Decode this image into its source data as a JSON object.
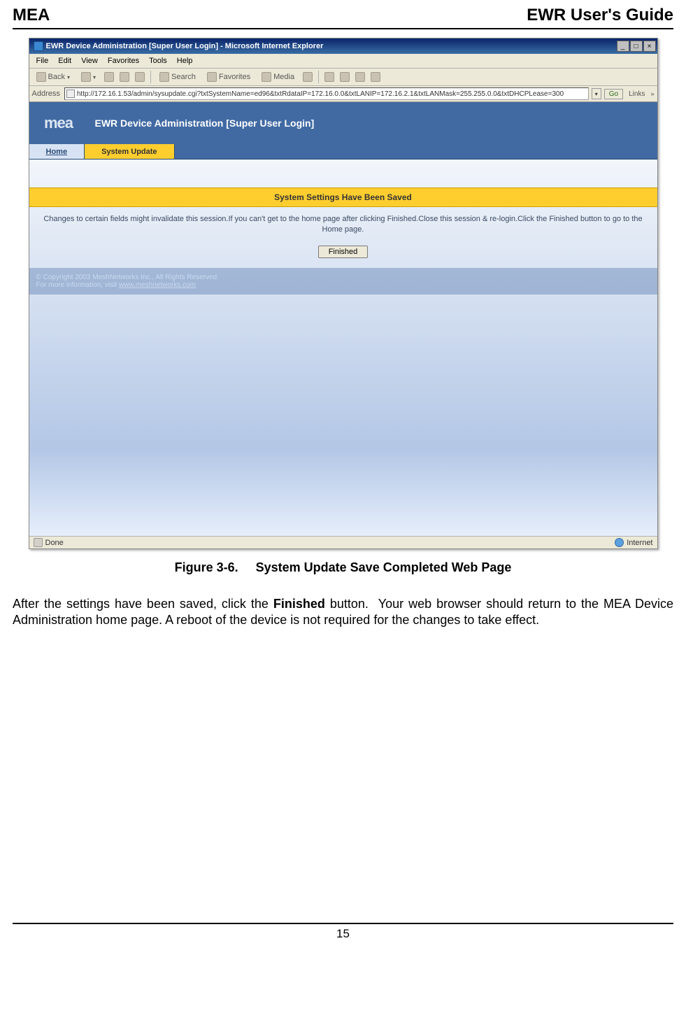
{
  "doc": {
    "header_left": "MEA",
    "header_right": "EWR User's Guide",
    "figure_label": "Figure 3-6.",
    "figure_title": "System Update Save Completed Web Page",
    "body_para": "After the settings have been saved, click the Finished button.  Your web browser should return to the MEA Device Administration home page. A reboot of the device is not required for the changes to take effect.",
    "bold_word": "Finished",
    "page_num": "15"
  },
  "window": {
    "title": "EWR Device Administration [Super User Login] - Microsoft Internet Explorer",
    "min": "_",
    "max": "□",
    "close": "×"
  },
  "menu": {
    "file": "File",
    "edit": "Edit",
    "view": "View",
    "favorites": "Favorites",
    "tools": "Tools",
    "help": "Help"
  },
  "toolbar": {
    "back": "Back",
    "search": "Search",
    "favorites": "Favorites",
    "media": "Media"
  },
  "address": {
    "label": "Address",
    "url": "http://172.16.1.53/admin/sysupdate.cgi?txtSystemName=ed96&txtRdataIP=172.16.0.0&txtLANIP=172.16.2.1&txtLANMask=255.255.0.0&txtDHCPLease=300",
    "go": "Go",
    "links": "Links"
  },
  "admin": {
    "logo": "mea",
    "title": "EWR Device Administration [Super User Login]",
    "tab_home": "Home",
    "tab_update": "System Update",
    "banner": "System Settings Have Been Saved",
    "message": "Changes to certain fields might invalidate this session.If you can't get to the home page after clicking Finished.Close this session & re-login.Click the Finished button to go to the Home page.",
    "finished": "Finished",
    "copyright": "© Copyright 2003 MeshNetworks Inc., All Rights Reserved.",
    "info_prefix": "For more information, visit ",
    "info_link": "www.meshnetworks.com"
  },
  "status": {
    "done": "Done",
    "zone": "Internet"
  }
}
